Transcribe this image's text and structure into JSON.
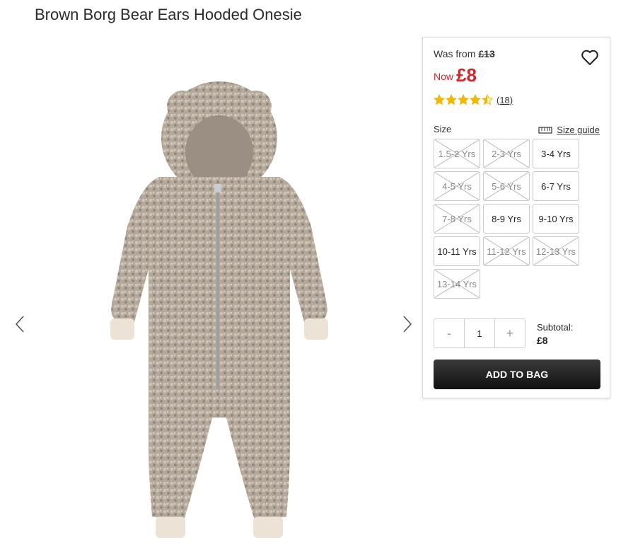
{
  "product": {
    "title": "Brown Borg Bear Ears Hooded Onesie"
  },
  "price": {
    "was_label": "Was from",
    "was_value": "£13",
    "now_label": "Now",
    "now_value": "£8"
  },
  "rating": {
    "stars": 4.5,
    "count_text": "(18)"
  },
  "size": {
    "label": "Size",
    "guide_label": "Size guide",
    "options": [
      {
        "label": "1.5-2 Yrs",
        "available": false
      },
      {
        "label": "2-3 Yrs",
        "available": false
      },
      {
        "label": "3-4 Yrs",
        "available": true
      },
      {
        "label": "4-5 Yrs",
        "available": false
      },
      {
        "label": "5-6 Yrs",
        "available": false
      },
      {
        "label": "6-7 Yrs",
        "available": true
      },
      {
        "label": "7-8 Yrs",
        "available": false
      },
      {
        "label": "8-9 Yrs",
        "available": true
      },
      {
        "label": "9-10 Yrs",
        "available": true
      },
      {
        "label": "10-11 Yrs",
        "available": true
      },
      {
        "label": "11-12 Yrs",
        "available": false
      },
      {
        "label": "12-13 Yrs",
        "available": false
      },
      {
        "label": "13-14 Yrs",
        "available": false
      }
    ]
  },
  "quantity": {
    "minus": "-",
    "value": "1",
    "plus": "+"
  },
  "subtotal": {
    "label": "Subtotal:",
    "value": "£8"
  },
  "actions": {
    "add_to_bag": "ADD TO BAG"
  },
  "colors": {
    "sale_red": "#d0262c",
    "star_gold": "#f2b705",
    "button_dark": "#1a1a1a"
  },
  "icons": {
    "prev": "chevron-left-icon",
    "next": "chevron-right-icon",
    "wishlist": "heart-icon",
    "size_guide": "ruler-icon"
  }
}
